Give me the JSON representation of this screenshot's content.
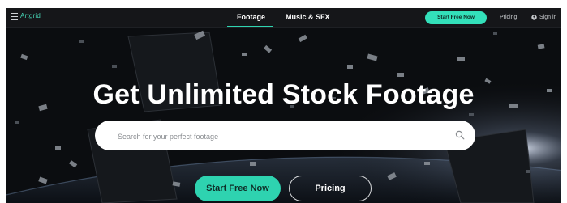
{
  "nav": {
    "logo": "Artgrid",
    "tabs": [
      {
        "label": "Footage",
        "active": true
      },
      {
        "label": "Music & SFX",
        "active": false
      }
    ],
    "start_label": "Start Free Now",
    "pricing_label": "Pricing",
    "signin_label": "Sign in"
  },
  "hero": {
    "headline": "Get Unlimited Stock Footage",
    "search_placeholder": "Search for your perfect footage",
    "start_label": "Start Free Now",
    "pricing_label": "Pricing"
  },
  "colors": {
    "accent": "#2ed3b0",
    "nav_bg": "#151619",
    "hero_bg": "#0b0d10"
  },
  "icons": [
    "menu-icon",
    "user-icon",
    "search-icon"
  ]
}
